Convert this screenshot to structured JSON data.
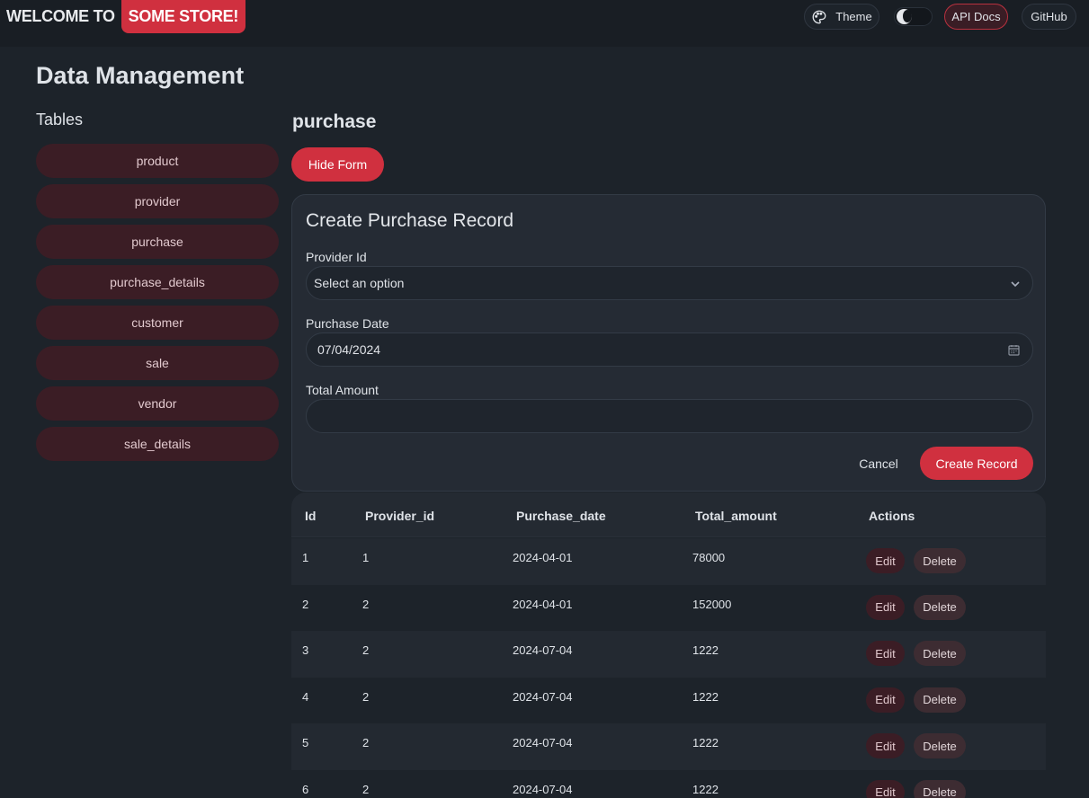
{
  "navbar": {
    "brand_prefix": "WELCOME TO",
    "brand_highlight": "SOME STORE!",
    "theme_label": "Theme",
    "api_docs_label": "API Docs",
    "github_label": "GitHub",
    "dark_mode_on": true
  },
  "page": {
    "title": "Data Management",
    "tables_heading": "Tables",
    "tables": [
      "product",
      "provider",
      "purchase",
      "purchase_details",
      "customer",
      "sale",
      "vendor",
      "sale_details"
    ],
    "selected_table": "purchase"
  },
  "section": {
    "title": "purchase",
    "hide_form_label": "Hide Form"
  },
  "form": {
    "title": "Create Purchase Record",
    "provider_label": "Provider Id",
    "provider_value": "Select an option",
    "date_label": "Purchase Date",
    "date_value": "07/04/2024",
    "amount_label": "Total Amount",
    "amount_value": "",
    "cancel_label": "Cancel",
    "create_label": "Create Record"
  },
  "table": {
    "headers": [
      "Id",
      "Provider_id",
      "Purchase_date",
      "Total_amount",
      "Actions"
    ],
    "edit_label": "Edit",
    "delete_label": "Delete",
    "rows": [
      {
        "id": "1",
        "provider_id": "1",
        "purchase_date": "2024-04-01",
        "total_amount": "78000"
      },
      {
        "id": "2",
        "provider_id": "2",
        "purchase_date": "2024-04-01",
        "total_amount": "152000"
      },
      {
        "id": "3",
        "provider_id": "2",
        "purchase_date": "2024-07-04",
        "total_amount": "1222"
      },
      {
        "id": "4",
        "provider_id": "2",
        "purchase_date": "2024-07-04",
        "total_amount": "1222"
      },
      {
        "id": "5",
        "provider_id": "2",
        "purchase_date": "2024-07-04",
        "total_amount": "1222"
      },
      {
        "id": "6",
        "provider_id": "2",
        "purchase_date": "2024-07-04",
        "total_amount": "1222"
      }
    ]
  },
  "colors": {
    "accent": "#d0303f",
    "background": "#1d232a",
    "navbar": "#191e24",
    "card": "#252b34",
    "sidebar_item": "#3b1d25"
  },
  "icons": {
    "theme": "palette-icon",
    "select": "chevron-down-icon",
    "date": "calendar-icon",
    "toggle": "moon-icon"
  }
}
